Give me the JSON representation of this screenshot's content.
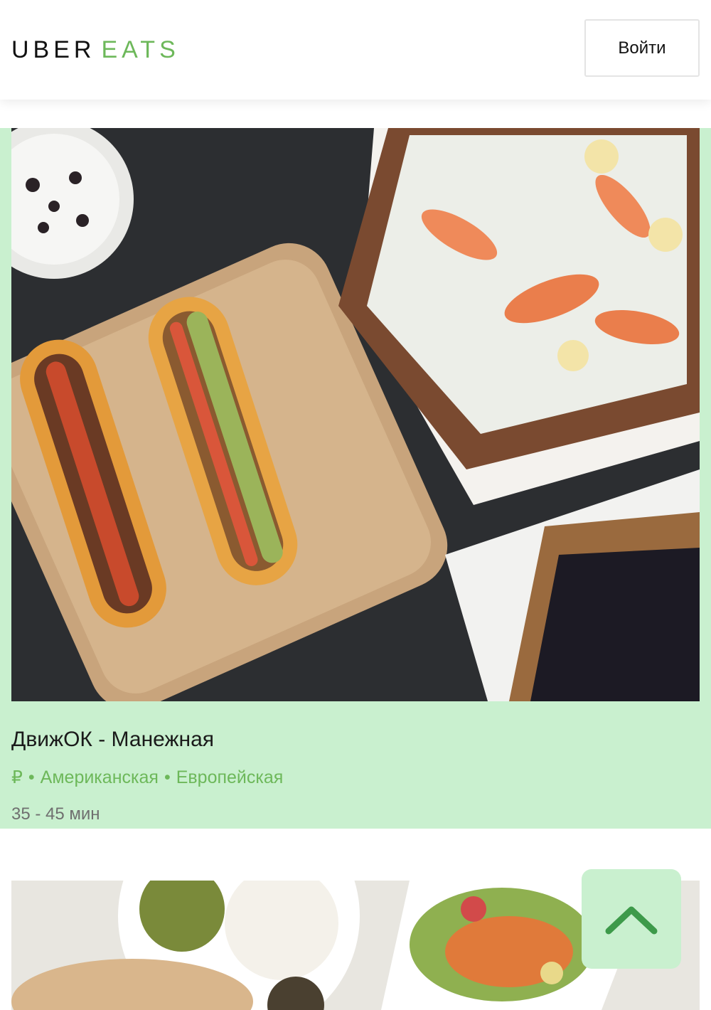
{
  "header": {
    "logo_primary": "UBER",
    "logo_secondary": "EATS",
    "login_label": "Войти"
  },
  "restaurants": [
    {
      "name": "ДвижОК - Манежная",
      "price": "₽",
      "cuisines": [
        "Американская",
        "Европейская"
      ],
      "separator": "•",
      "eta": "35 - 45 мин"
    }
  ],
  "colors": {
    "brand_green": "#6db85a",
    "card_highlight": "#c9f0cf",
    "text_dark": "#1a1a1a",
    "text_muted": "#6f6f6f"
  },
  "icons": {
    "scroll_top": "chevron-up-icon"
  }
}
